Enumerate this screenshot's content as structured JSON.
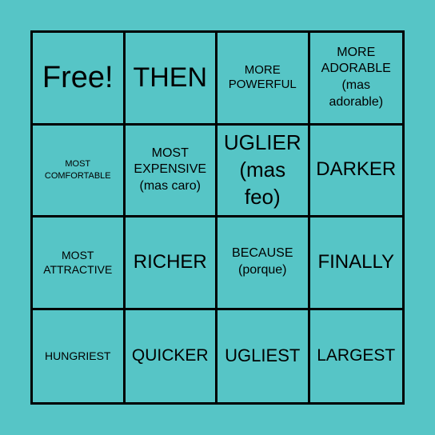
{
  "board": {
    "background_color": "#56c5c6",
    "grid_color": "#000000",
    "rows": [
      [
        {
          "text": "Free!",
          "size": "xl"
        },
        {
          "text": "THEN",
          "size": "l"
        },
        {
          "text": "MORE\nPOWERFUL",
          "size": "s"
        },
        {
          "text": "MORE\nADORABLE\n(mas\nadorable)",
          "size": "ms"
        }
      ],
      [
        {
          "text": "MOST\nCOMFORTABLE",
          "size": "xxs"
        },
        {
          "text": "MOST\nEXPENSIVE\n(mas caro)",
          "size": "ms"
        },
        {
          "text": "UGLIER\n(mas\nfeo)",
          "size": "l"
        },
        {
          "text": "DARKER",
          "size": "m"
        }
      ],
      [
        {
          "text": "MOST\nATTRACTIVE",
          "size": "xs"
        },
        {
          "text": "RICHER",
          "size": "m"
        },
        {
          "text": "BECAUSE\n(porque)",
          "size": "ms"
        },
        {
          "text": "FINALLY",
          "size": "m"
        }
      ],
      [
        {
          "text": "HUNGRIEST",
          "size": "xs"
        },
        {
          "text": "QUICKER",
          "size": "m"
        },
        {
          "text": "UGLIEST",
          "size": "m"
        },
        {
          "text": "LARGEST",
          "size": "m"
        }
      ]
    ]
  }
}
